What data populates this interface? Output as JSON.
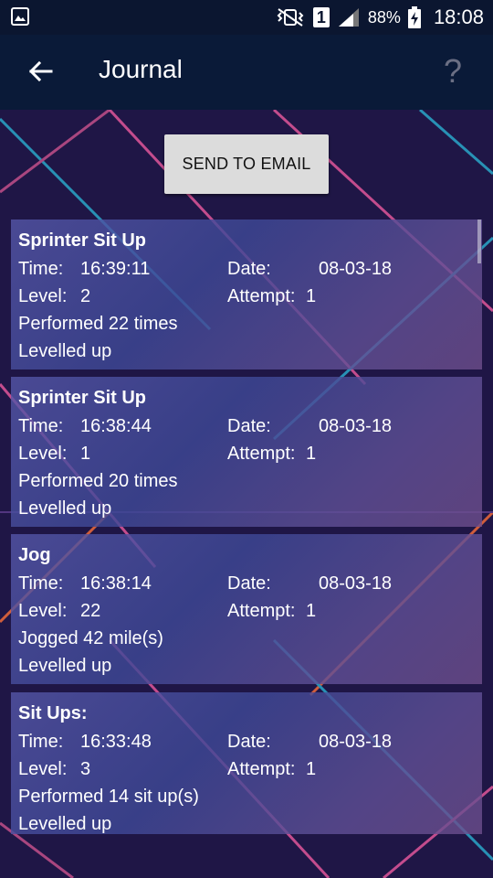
{
  "status_bar": {
    "sim_slot": "1",
    "battery": "88%",
    "time": "18:08"
  },
  "app_bar": {
    "title": "Journal",
    "back_icon": "arrow-left-icon",
    "help_icon": "question-mark-icon"
  },
  "send_button_label": "SEND TO EMAIL",
  "labels": {
    "time": "Time:",
    "date": "Date:",
    "level": "Level:",
    "attempt": "Attempt:"
  },
  "entries": [
    {
      "title": "Sprinter Sit Up",
      "time": "16:39:11",
      "date": "08-03-18",
      "level": "2",
      "attempt": "1",
      "detail": "Performed 22 times",
      "status": "Levelled up"
    },
    {
      "title": "Sprinter Sit Up",
      "time": "16:38:44",
      "date": "08-03-18",
      "level": "1",
      "attempt": "1",
      "detail": "Performed 20 times",
      "status": "Levelled up"
    },
    {
      "title": "Jog",
      "time": "16:38:14",
      "date": "08-03-18",
      "level": "22",
      "attempt": "1",
      "detail": "Jogged 42 mile(s)",
      "status": "Levelled up"
    },
    {
      "title": "Sit Ups:",
      "time": "16:33:48",
      "date": "08-03-18",
      "level": "3",
      "attempt": "1",
      "detail": "Performed 14 sit up(s)",
      "status": "Levelled up"
    }
  ]
}
